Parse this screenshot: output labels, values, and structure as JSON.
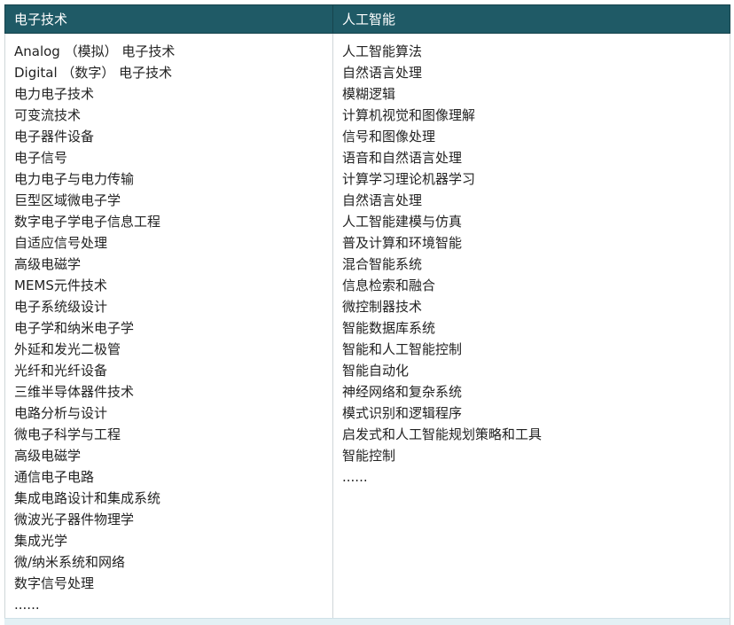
{
  "columns": [
    {
      "header": "电子技术",
      "items": [
        "Analog （模拟） 电子技术",
        "Digital （数字） 电子技术",
        "电力电子技术",
        "可变流技术",
        "电子器件设备",
        "电子信号",
        "电力电子与电力传输",
        "巨型区域微电子学",
        "数字电子学电子信息工程",
        "自适应信号处理",
        "高级电磁学",
        "MEMS元件技术",
        "电子系统级设计",
        "电子学和纳米电子学",
        "外延和发光二极管",
        "光纤和光纤设备",
        "三维半导体器件技术",
        "电路分析与设计",
        "微电子科学与工程",
        "高级电磁学",
        "通信电子电路",
        "集成电路设计和集成系统",
        "微波光子器件物理学",
        "集成光学",
        "微/纳米系统和网络",
        "数字信号处理",
        "......"
      ]
    },
    {
      "header": "人工智能",
      "items": [
        "人工智能算法",
        "自然语言处理",
        "模糊逻辑",
        "计算机视觉和图像理解",
        "信号和图像处理",
        "语音和自然语言处理",
        "计算学习理论机器学习",
        "自然语言处理",
        "人工智能建模与仿真",
        "普及计算和环境智能",
        "混合智能系统",
        "信息检索和融合",
        "微控制器技术",
        "智能数据库系统",
        "智能和人工智能控制",
        "智能自动化",
        "神经网络和复杂系统",
        "模式识别和逻辑程序",
        "启发式和人工智能规划策略和工具",
        "智能控制",
        "......"
      ]
    }
  ]
}
